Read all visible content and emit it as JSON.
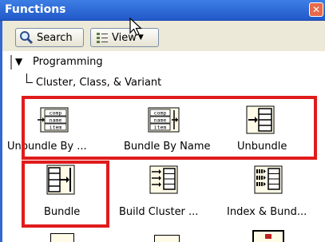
{
  "window": {
    "title": "Functions",
    "close_glyph": "✕"
  },
  "toolbar": {
    "search_label": "Search",
    "view_label": "View"
  },
  "tree": {
    "root": "Programming",
    "child": "Cluster, Class, & Variant"
  },
  "icon_text": {
    "comp": "comp",
    "name": "name",
    "item": "item"
  },
  "palette": {
    "row1": [
      "Unbundle By ...",
      "Bundle By Name",
      "Unbundle"
    ],
    "row2": [
      "Bundle",
      "Build Cluster ...",
      "Index & Bund..."
    ]
  },
  "colors": {
    "title_bar": "#2d68d8",
    "highlight": "#e01b1b",
    "toolbar_bg": "#ece9d8"
  }
}
